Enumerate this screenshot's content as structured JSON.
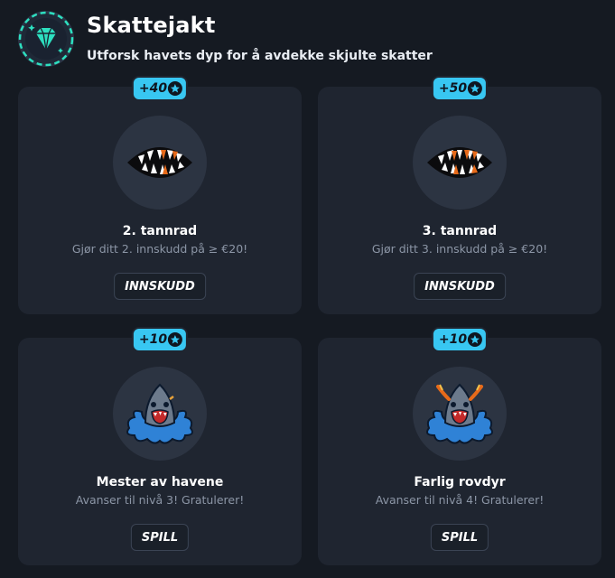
{
  "header": {
    "title": "Skattejakt",
    "subtitle": "Utforsk havets dyp for å avdekke skjulte skatter",
    "logo_icon": "diamond-icon"
  },
  "colors": {
    "background": "#151a22",
    "card": "#1f2530",
    "badge": "#38c7f2",
    "accent_teal": "#2de0c0"
  },
  "cards": [
    {
      "badge": "+40",
      "badge_icon": "star-coin-icon",
      "icon": "jaws-icon",
      "title": "2. tannrad",
      "description": "Gjør ditt 2. innskudd på ≥ €20!",
      "button": "INNSKUDD"
    },
    {
      "badge": "+50",
      "badge_icon": "star-coin-icon",
      "icon": "jaws-icon",
      "title": "3. tannrad",
      "description": "Gjør ditt 3. innskudd på ≥ €20!",
      "button": "INNSKUDD"
    },
    {
      "badge": "+10",
      "badge_icon": "star-coin-icon",
      "icon": "shark-splash-icon",
      "title": "Mester av havene",
      "description": "Avanser til nivå 3! Gratulerer!",
      "button": "SPILL"
    },
    {
      "badge": "+10",
      "badge_icon": "star-coin-icon",
      "icon": "shark-splash-icon",
      "title": "Farlig rovdyr",
      "description": "Avanser til nivå 4! Gratulerer!",
      "button": "SPILL"
    }
  ]
}
